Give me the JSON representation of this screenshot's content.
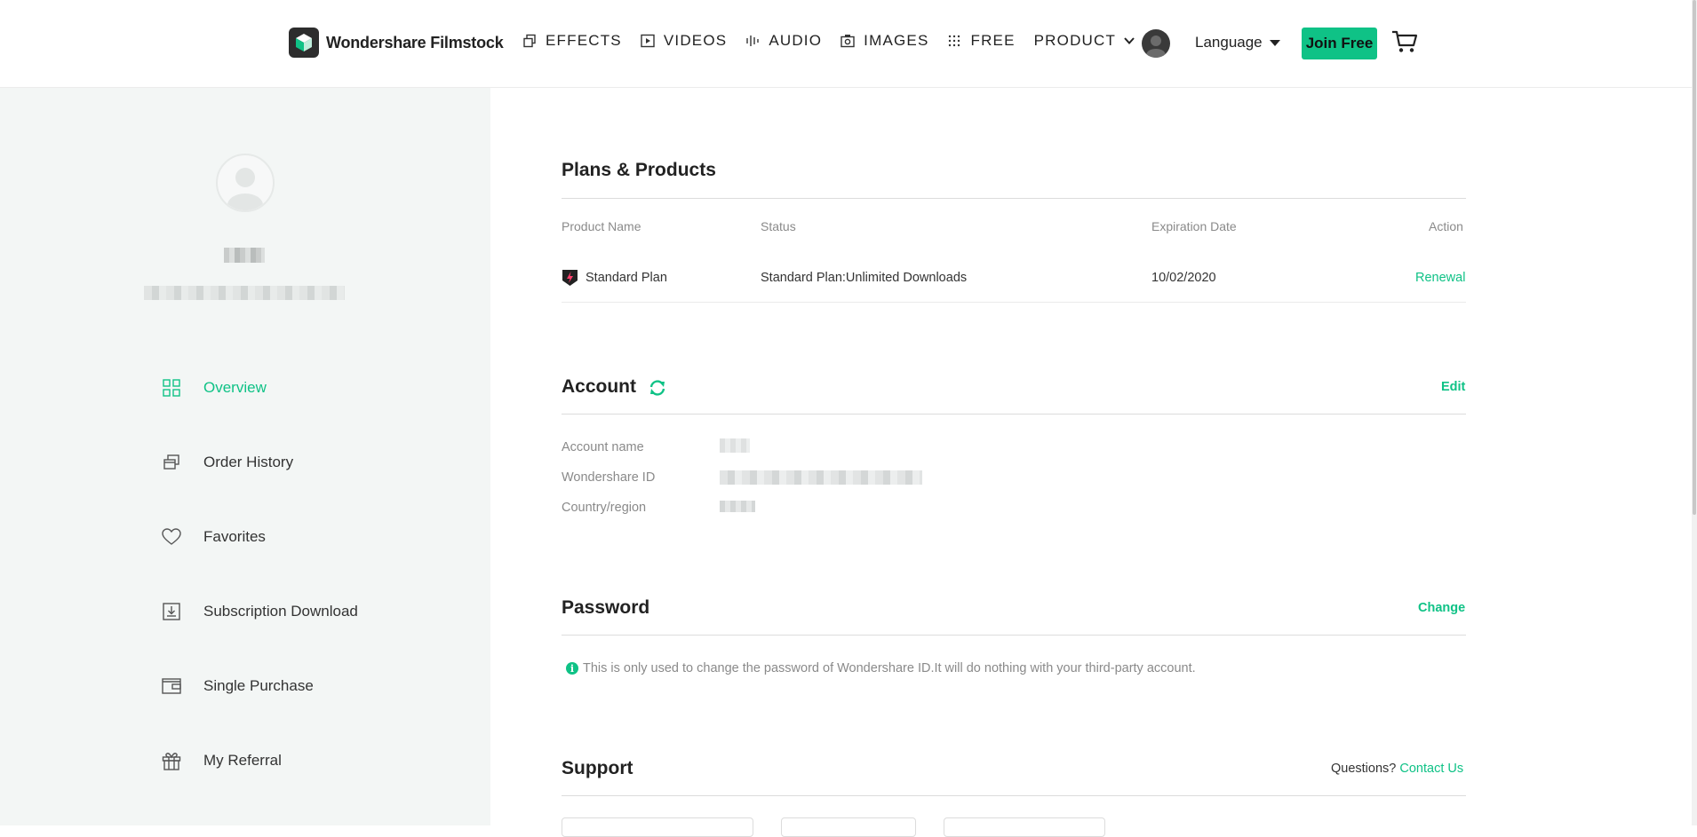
{
  "header": {
    "brand": "Wondershare Filmstock",
    "nav": [
      {
        "label": "EFFECTS",
        "icon": "effects-icon"
      },
      {
        "label": "VIDEOS",
        "icon": "play-icon"
      },
      {
        "label": "AUDIO",
        "icon": "audio-wave-icon"
      },
      {
        "label": "IMAGES",
        "icon": "camera-icon"
      },
      {
        "label": "FREE",
        "icon": "grid-dots-icon"
      },
      {
        "label": "PRODUCT",
        "icon": "chevron-down-icon"
      }
    ],
    "language": "Language",
    "join": "Join Free"
  },
  "sidebar": {
    "items": [
      {
        "label": "Overview",
        "icon": "overview-grid-icon",
        "active": true
      },
      {
        "label": "Order History",
        "icon": "order-history-icon"
      },
      {
        "label": "Favorites",
        "icon": "heart-icon"
      },
      {
        "label": "Subscription Download",
        "icon": "download-icon"
      },
      {
        "label": "Single Purchase",
        "icon": "wallet-icon"
      },
      {
        "label": "My Referral",
        "icon": "gift-icon"
      }
    ]
  },
  "plans": {
    "title": "Plans & Products",
    "columns": {
      "name": "Product Name",
      "status": "Status",
      "expiration": "Expiration Date",
      "action": "Action"
    },
    "row": {
      "name": "Standard Plan",
      "status": "Standard Plan:Unlimited Downloads",
      "expiration": "10/02/2020",
      "action": "Renewal"
    }
  },
  "account": {
    "title": "Account",
    "edit": "Edit",
    "labels": {
      "name": "Account name",
      "id": "Wondershare ID",
      "region": "Country/region"
    }
  },
  "password": {
    "title": "Password",
    "change": "Change",
    "note": "This is only used to change the password of Wondershare ID.It will do nothing with your third-party account."
  },
  "support": {
    "title": "Support",
    "question": "Questions?",
    "contact": "Contact Us"
  },
  "colors": {
    "accent": "#0fc286",
    "sidebar_bg": "#f3f6f5"
  }
}
